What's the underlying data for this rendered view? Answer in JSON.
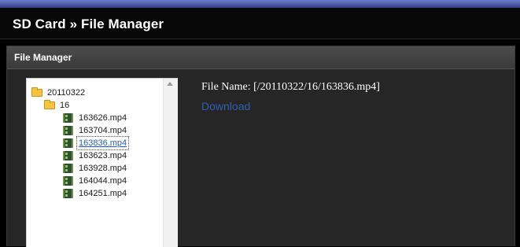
{
  "header": {
    "title": "SD Card » File Manager"
  },
  "panel": {
    "title": "File Manager"
  },
  "tree": {
    "root_folder": "20110322",
    "sub_folder": "16",
    "files": [
      "163626.mp4",
      "163704.mp4",
      "163836.mp4",
      "163623.mp4",
      "163928.mp4",
      "164044.mp4",
      "164251.mp4"
    ],
    "selected_file": "163836.mp4"
  },
  "details": {
    "file_name_text": "File Name: [/20110322/16/163836.mp4]",
    "download_label": "Download"
  },
  "colors": {
    "title_bar": "#080808",
    "top_strip": "#4a5aa8",
    "panel_header": "#444444",
    "link": "#2f5fb3",
    "folder": "#f5c542"
  },
  "icons": {
    "folder": "folder-icon",
    "file": "video-file-icon"
  }
}
